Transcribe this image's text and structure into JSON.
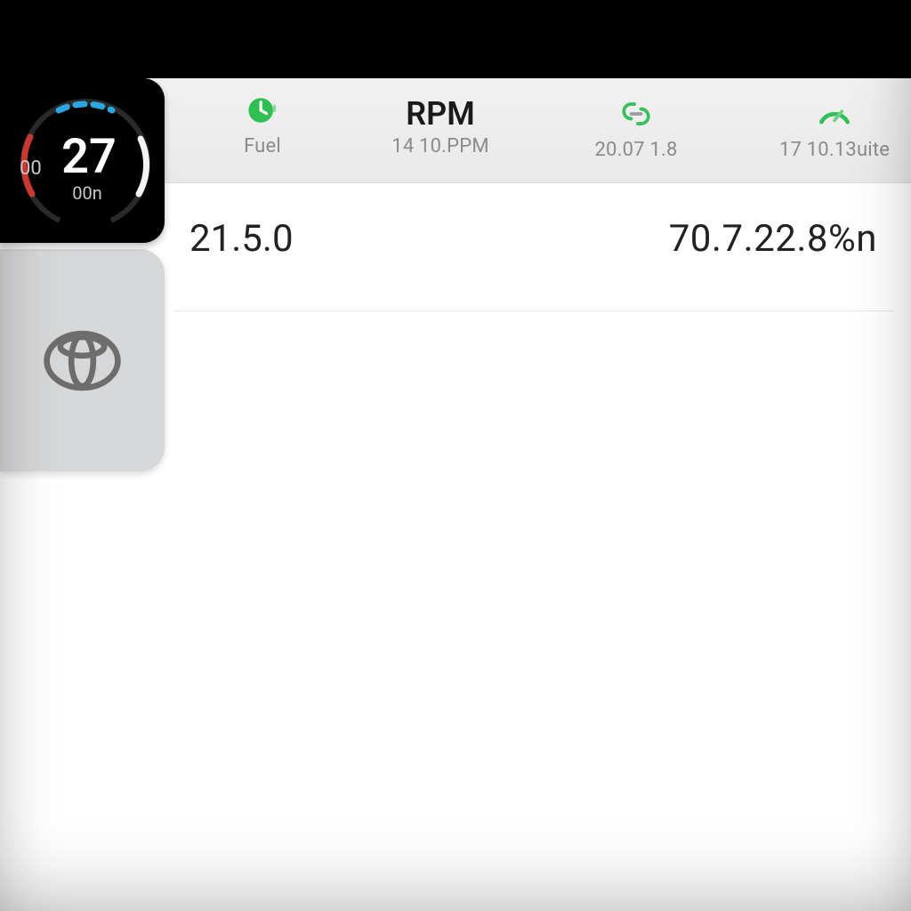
{
  "gauge": {
    "main": "27",
    "side": "00",
    "sub": "00n"
  },
  "metrics": {
    "fuel": {
      "label": "Fuel"
    },
    "rpm": {
      "label": "RPM",
      "sub": "14 10.PPM"
    },
    "link": {
      "sub": "20.07 1.8"
    },
    "gauge": {
      "sub": "17 10.13uite"
    }
  },
  "values": {
    "left": "21.5.0",
    "right": "70.7.22.8%n"
  }
}
